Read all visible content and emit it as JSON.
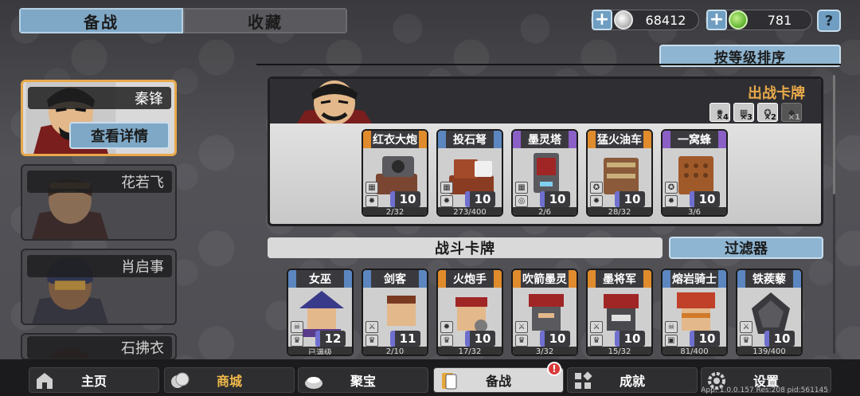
{
  "tabs": [
    {
      "label": "备战"
    },
    {
      "label": "收藏"
    }
  ],
  "currency": {
    "silver": "68412",
    "green": "781",
    "plus": "+",
    "help": "?"
  },
  "sort_label": "按等级排序",
  "heroes": [
    {
      "name": "秦锋"
    },
    {
      "name": "花若飞"
    },
    {
      "name": "肖启事"
    },
    {
      "name": "石拂衣"
    }
  ],
  "detail_button": "查看详情",
  "deck": {
    "title": "出战卡牌",
    "multipliers": [
      "×4",
      "×3",
      "×2",
      "×1"
    ],
    "cards": [
      {
        "title": "红衣大炮",
        "level": "10",
        "progress": "2/32",
        "color": "orange"
      },
      {
        "title": "投石弩",
        "level": "10",
        "progress": "273/400",
        "color": "blue"
      },
      {
        "title": "墨灵塔",
        "level": "10",
        "progress": "2/6",
        "color": "purple"
      },
      {
        "title": "猛火油车",
        "level": "10",
        "progress": "28/32",
        "color": "orange"
      },
      {
        "title": "一窝蜂",
        "level": "10",
        "progress": "3/6",
        "color": "purple"
      }
    ]
  },
  "battle_label": "战斗卡牌",
  "filter_label": "过滤器",
  "battle_cards": [
    {
      "title": "女巫",
      "level": "12",
      "progress": "已满级",
      "color": "blue"
    },
    {
      "title": "剑客",
      "level": "11",
      "progress": "2/10",
      "color": "blue"
    },
    {
      "title": "火炮手",
      "level": "10",
      "progress": "17/32",
      "color": "orange"
    },
    {
      "title": "吹箭墨灵",
      "level": "10",
      "progress": "3/32",
      "color": "orange"
    },
    {
      "title": "墨将军",
      "level": "10",
      "progress": "15/32",
      "color": "orange"
    },
    {
      "title": "熔岩骑士",
      "level": "10",
      "progress": "81/400",
      "color": "blue"
    },
    {
      "title": "铁蒺藜",
      "level": "10",
      "progress": "139/400",
      "color": "blue"
    }
  ],
  "nav": [
    {
      "label": "主页"
    },
    {
      "label": "商城"
    },
    {
      "label": "聚宝"
    },
    {
      "label": "备战"
    },
    {
      "label": "成就"
    },
    {
      "label": "设置"
    }
  ],
  "nav_alert": "!",
  "version": "App: 1.0.0.157 Res:208 pid:561145"
}
